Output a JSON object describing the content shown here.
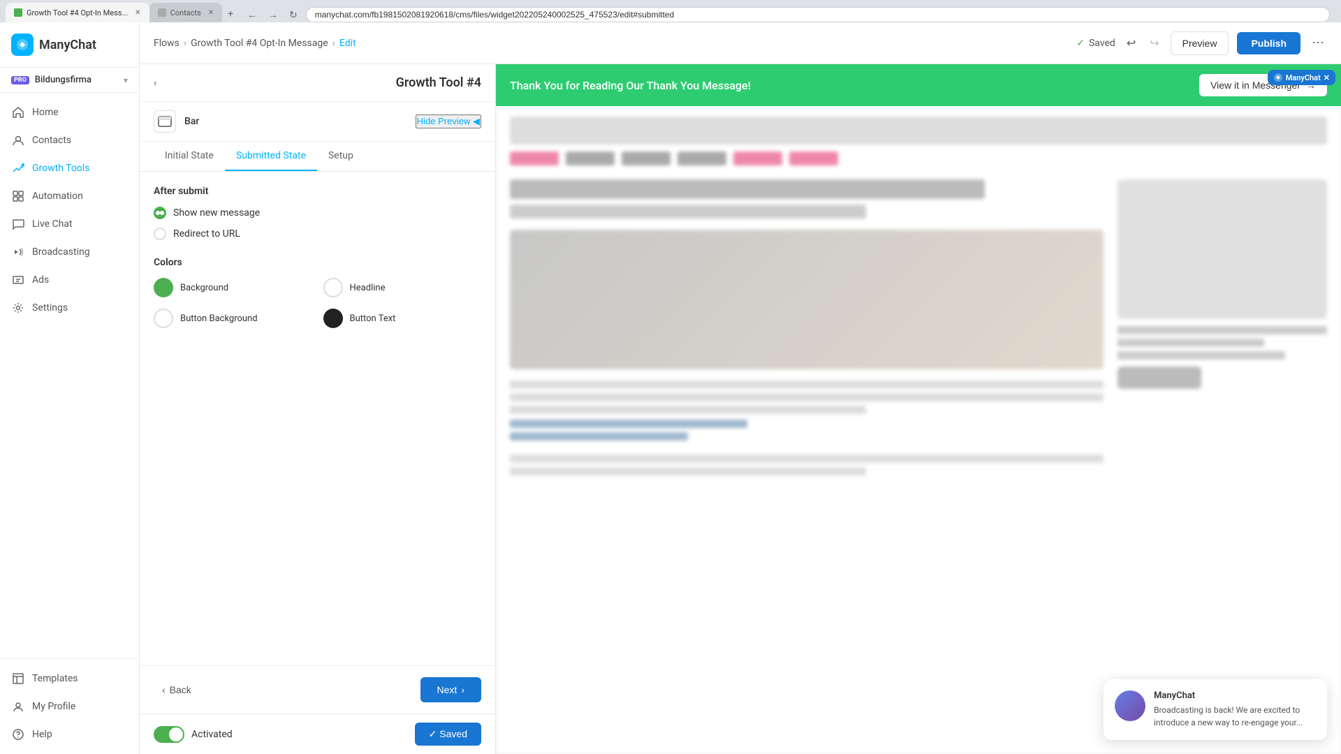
{
  "browser": {
    "address": "manychat.com/fb198150208192061​8/cms/files/widget202205240002525_475523/edit#submitted",
    "tab1_title": "Growth Tool #4 Opt-In Mess...",
    "tab2_title": "Contacts"
  },
  "header": {
    "breadcrumb": {
      "flows": "Flows",
      "sep1": ">",
      "tool_name": "Growth Tool #4 Opt-In Message",
      "sep2": ">",
      "current": "Edit"
    },
    "saved_label": "Saved",
    "preview_label": "Preview",
    "publish_label": "Publish",
    "more_label": "⋯"
  },
  "sidebar": {
    "logo_text": "ManyChat",
    "workspace": {
      "badge": "PRO",
      "name": "Bildungsfirma"
    },
    "nav": [
      {
        "id": "home",
        "label": "Home",
        "icon": "home"
      },
      {
        "id": "contacts",
        "label": "Contacts",
        "icon": "contacts"
      },
      {
        "id": "growth-tools",
        "label": "Growth Tools",
        "icon": "growth"
      },
      {
        "id": "automation",
        "label": "Automation",
        "icon": "automation"
      },
      {
        "id": "live-chat",
        "label": "Live Chat",
        "icon": "chat"
      },
      {
        "id": "broadcasting",
        "label": "Broadcasting",
        "icon": "broadcast"
      },
      {
        "id": "ads",
        "label": "Ads",
        "icon": "ads"
      },
      {
        "id": "settings",
        "label": "Settings",
        "icon": "settings"
      }
    ],
    "bottom_nav": [
      {
        "id": "templates",
        "label": "Templates",
        "icon": "templates"
      },
      {
        "id": "my-profile",
        "label": "My Profile",
        "icon": "profile"
      },
      {
        "id": "help",
        "label": "Help",
        "icon": "help"
      }
    ]
  },
  "panel": {
    "title": "Growth Tool #4",
    "back_label": "◀",
    "icon_label": "Bar",
    "hide_preview_label": "Hide Preview ◀",
    "tabs": [
      {
        "id": "initial",
        "label": "Initial State"
      },
      {
        "id": "submitted",
        "label": "Submitted State",
        "active": true
      },
      {
        "id": "setup",
        "label": "Setup"
      }
    ],
    "after_submit_section": "After submit",
    "radio_options": [
      {
        "id": "show-message",
        "label": "Show new message",
        "selected": true
      },
      {
        "id": "redirect-url",
        "label": "Redirect to URL",
        "selected": false
      }
    ],
    "colors_section": "Colors",
    "colors": [
      {
        "id": "background",
        "label": "Background",
        "color": "#4CAF50",
        "type": "filled"
      },
      {
        "id": "headline",
        "label": "Headline",
        "color": "#ffffff",
        "type": "empty"
      },
      {
        "id": "button-bg",
        "label": "Button Background",
        "color": "#ffffff",
        "type": "empty"
      },
      {
        "id": "button-text",
        "label": "Button Text",
        "color": "#222222",
        "type": "dark"
      }
    ],
    "back_btn": "Back",
    "next_btn": "Next",
    "toggle_label": "Activated",
    "saved_btn": "✓ Saved"
  },
  "bar_overlay": {
    "message": "Thank You for Reading Our Thank You Message!",
    "cta": "View it in Messenger",
    "cta_arrow": "→"
  },
  "chat_popup": {
    "name": "ManyChat",
    "message": "Broadcasting is back! We are excited to introduce a new way to re-engage your..."
  }
}
